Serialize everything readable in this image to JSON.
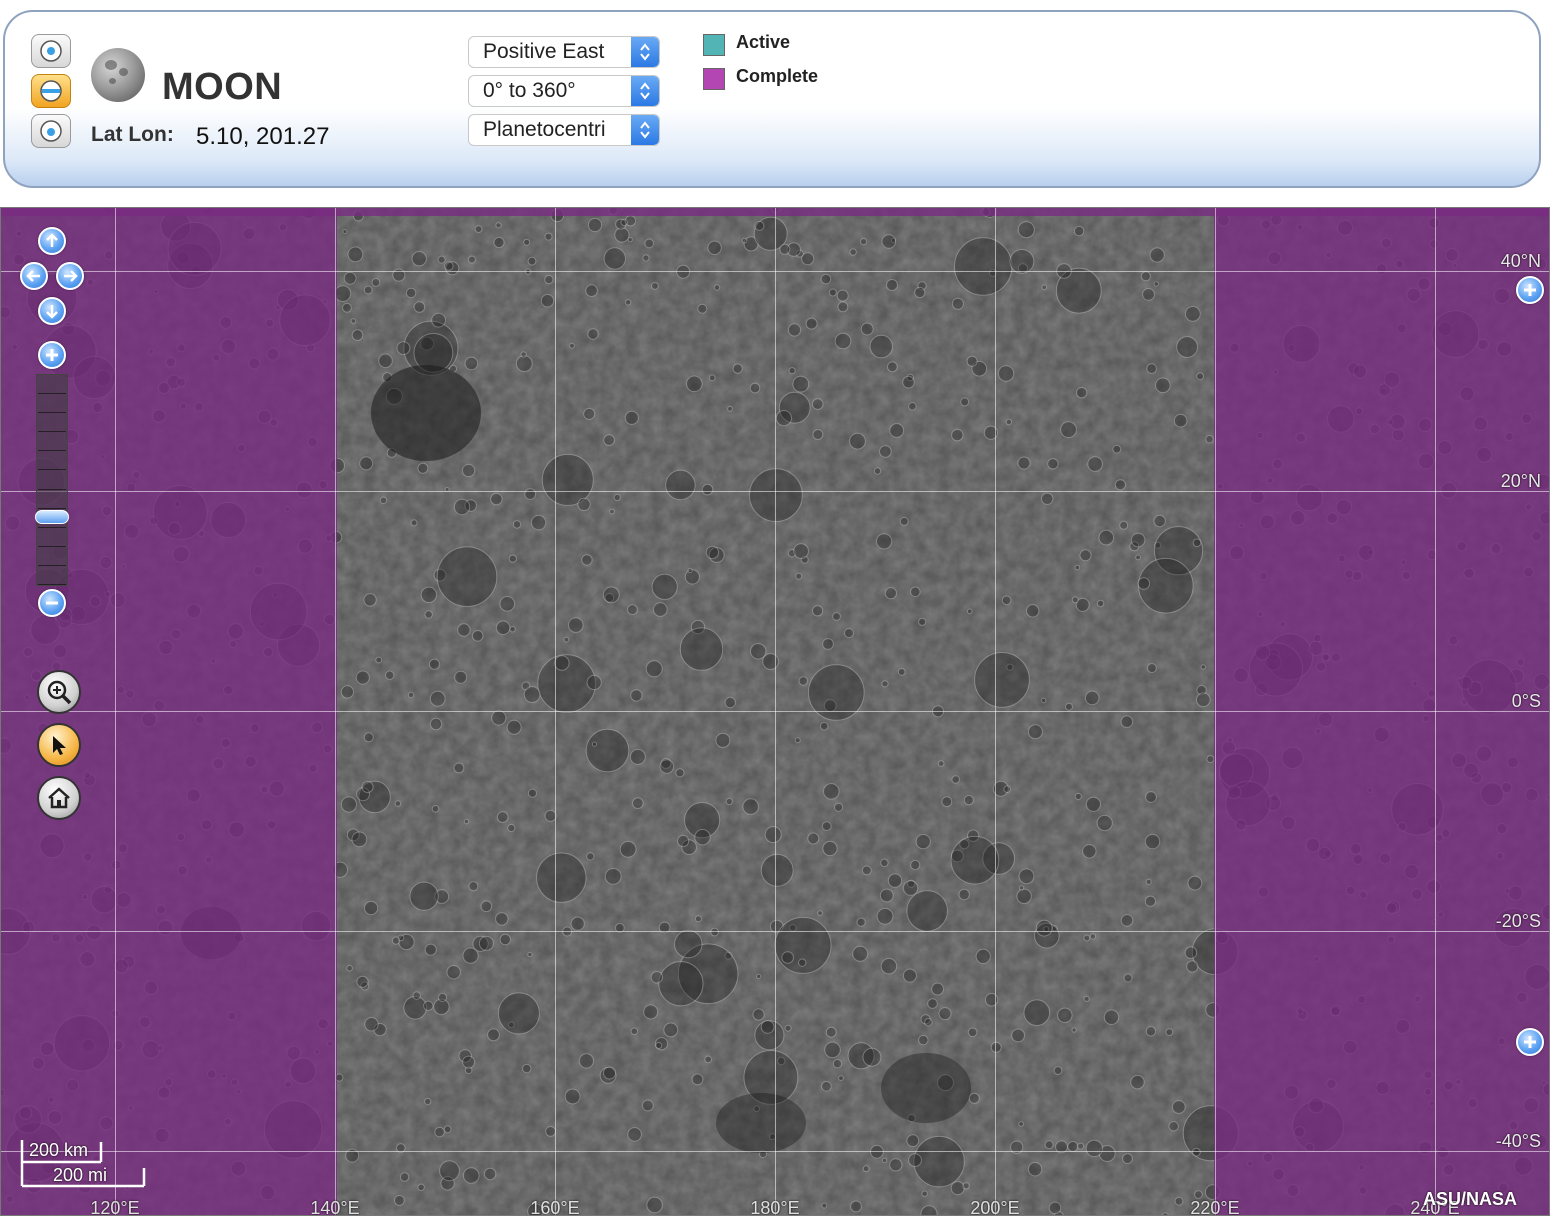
{
  "header": {
    "body_name": "MOON",
    "latlon_label": "Lat Lon:",
    "latlon_value": "5.10, 201.27",
    "projection_buttons": [
      {
        "name": "north-polar-projection-button",
        "icon": "north-pole-icon",
        "active": false
      },
      {
        "name": "cylindrical-projection-button",
        "icon": "equator-icon",
        "active": true
      },
      {
        "name": "south-polar-projection-button",
        "icon": "south-pole-icon",
        "active": false
      }
    ],
    "selects": {
      "longitude_direction": "Positive East",
      "longitude_range": "0° to 360°",
      "latitude_type": "Planetocentri"
    },
    "legend": [
      {
        "label": "Active",
        "color": "#52b4b4"
      },
      {
        "label": "Complete",
        "color": "#b446b4"
      }
    ]
  },
  "map": {
    "lat_labels": [
      "40°N",
      "20°N",
      "0°S",
      "-20°S",
      "-40°S"
    ],
    "lon_labels": [
      "120°E",
      "140°E",
      "160°E",
      "180°E",
      "200°E",
      "220°E",
      "240°E"
    ],
    "colors": {
      "complete_overlay": "#7a2a82",
      "surface_gray": "#5a5a5a"
    },
    "scale": {
      "km": "200 km",
      "mi": "200 mi"
    },
    "credit": "ASU/NASA",
    "zoom_steps": 11,
    "zoom_level_index": 7
  }
}
